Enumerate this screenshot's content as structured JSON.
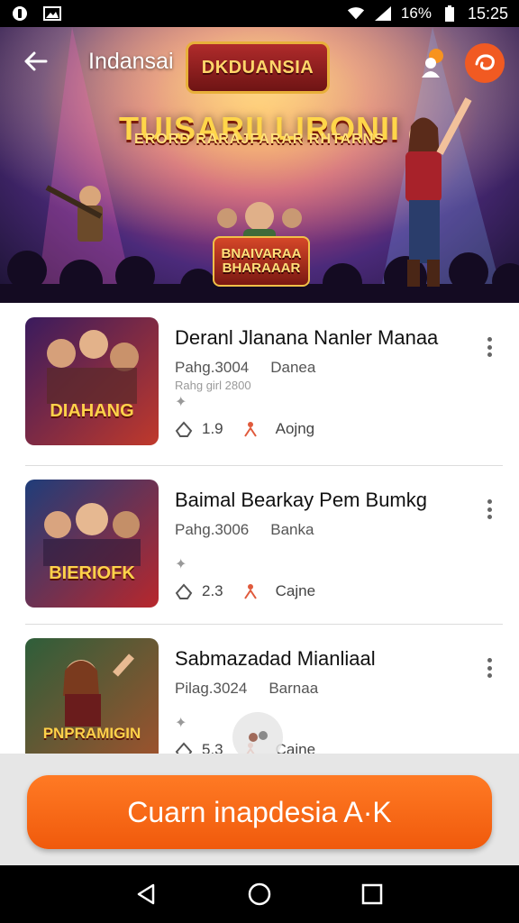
{
  "status_bar": {
    "time": "15:25",
    "battery_text": "16%",
    "icons": [
      "app-notification-icon",
      "image-icon",
      "wifi-icon",
      "signal-icon",
      "battery-icon"
    ]
  },
  "app_bar": {
    "title": "Indansai",
    "logo_text": "DKDUANSIA"
  },
  "banner": {
    "headline": "TUISARII LIRONII",
    "subheadline": "ERORD RARAJFARAR RHTARNS",
    "badge_text": "BNAIVARAA BHARAAAR"
  },
  "items": [
    {
      "title": "Deranl Jlanana Nanler Manaa",
      "date": "Pahg.3004",
      "category": "Danea",
      "subtext": "Rahg girl 2800",
      "rating": "1.9",
      "tag": "Aojng",
      "thumb_text": "DIAHANG",
      "thumb_colors": [
        "#3a1b5e",
        "#c0392b"
      ]
    },
    {
      "title": "Baimal Bearkay Pem Bumkg",
      "date": "Pahg.3006",
      "category": "Banka",
      "subtext": "",
      "rating": "2.3",
      "tag": "Cajne",
      "thumb_text": "BIERIOFK",
      "thumb_colors": [
        "#1f3d7a",
        "#b8272c"
      ]
    },
    {
      "title": "Sabmazadad Mianliaal",
      "date": "Pilag.3024",
      "category": "Barnaa",
      "subtext": "",
      "rating": "5.3",
      "tag": "Cajne",
      "thumb_text": "PNPRAMIGIN",
      "thumb_colors": [
        "#2e5e3a",
        "#a0522d"
      ]
    }
  ],
  "cta": {
    "label": "Cuarn inapdesia A·K"
  },
  "nav": [
    "back-nav-icon",
    "home-nav-icon",
    "recents-nav-icon"
  ],
  "colors": {
    "accent": "#f05a0c",
    "status_bar": "#000000"
  }
}
